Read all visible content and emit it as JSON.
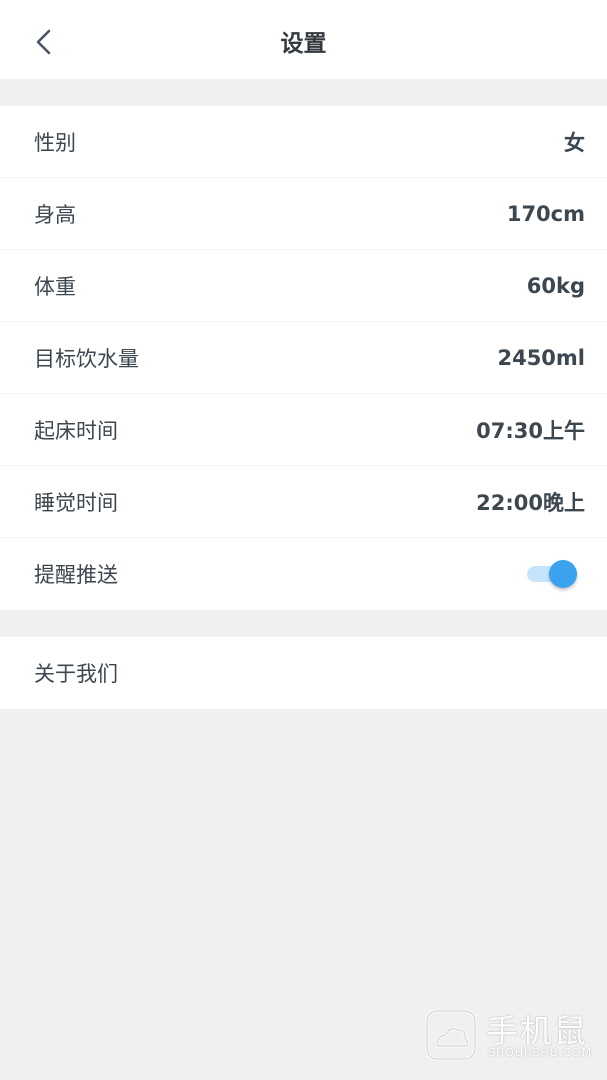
{
  "header": {
    "title": "设置",
    "back_icon": "chevron-left-icon"
  },
  "settings": [
    {
      "label": "性别",
      "value": "女"
    },
    {
      "label": "身高",
      "value": "170cm"
    },
    {
      "label": "体重",
      "value": "60kg"
    },
    {
      "label": "目标饮水量",
      "value": "2450ml"
    },
    {
      "label": "起床时间",
      "value": "07:30上午"
    },
    {
      "label": "睡觉时间",
      "value": "22:00晚上"
    },
    {
      "label": "提醒推送",
      "toggle_on": true
    }
  ],
  "about": {
    "label": "关于我们"
  },
  "watermark": {
    "main": "手机鼠",
    "sub": "SHOUJISHU.COM"
  },
  "colors": {
    "background": "#f0f0f0",
    "text": "#3d4750",
    "toggle_knob": "#3aa2ee",
    "toggle_track": "#c6e4fb"
  }
}
